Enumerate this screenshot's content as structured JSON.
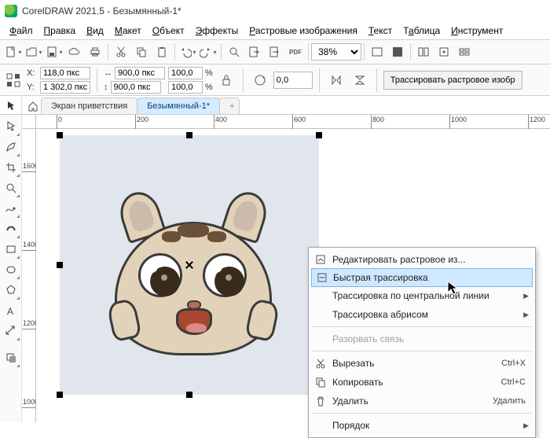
{
  "titlebar": {
    "title": "CorelDRAW 2021.5 - Безымянный-1*"
  },
  "menu": {
    "file": "Файл",
    "edit": "Правка",
    "view": "Вид",
    "layout": "Макет",
    "object": "Объект",
    "effects": "Эффекты",
    "bitmaps": "Растровые изображения",
    "text": "Текст",
    "table": "Таблица",
    "tools": "Инструмент"
  },
  "toolbar": {
    "zoom": "38%",
    "pdf": "PDF"
  },
  "propbar": {
    "x_label": "X:",
    "y_label": "Y:",
    "x": "118,0 пкс",
    "y": "1 302,0 пкс",
    "w": "900,0 пкс",
    "h": "900,0 пкс",
    "sx": "100,0",
    "sy": "100,0",
    "pct": "%",
    "angle": "0,0",
    "trace": "Трассировать растровое изобр"
  },
  "tabs": {
    "welcome": "Экран приветствия",
    "doc1": "Безымянный-1*",
    "add": "+"
  },
  "ruler_h": [
    "0",
    "200",
    "400",
    "600",
    "800",
    "1000",
    "1200"
  ],
  "ruler_v": [
    "1600",
    "1400",
    "1200",
    "1000"
  ],
  "ctx": {
    "edit_bitmap": "Редактировать растровое из...",
    "quick_trace": "Быстрая трассировка",
    "centerline": "Трассировка по центральной линии",
    "outline_trace": "Трассировка абрисом",
    "break_link": "Разорвать связь",
    "cut": "Вырезать",
    "cut_sc": "Ctrl+X",
    "copy": "Копировать",
    "copy_sc": "Ctrl+C",
    "delete": "Удалить",
    "delete_sc": "Удалить",
    "order": "Порядок"
  }
}
